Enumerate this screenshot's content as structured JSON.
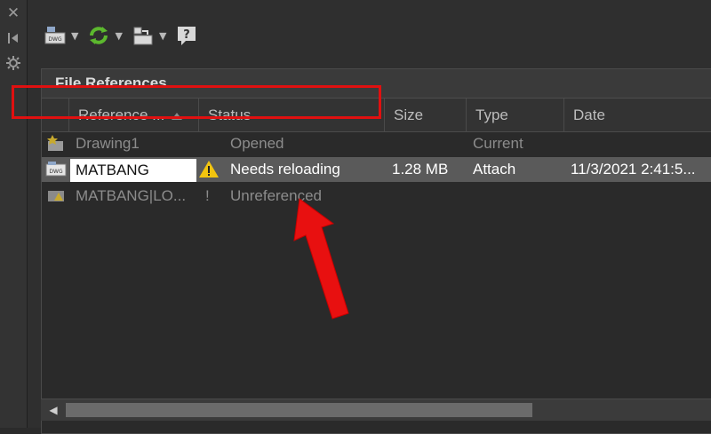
{
  "panel": {
    "title": "File References"
  },
  "toolbar": {
    "buttons": [
      {
        "icon": "attach-dwg-icon",
        "has_dropdown": true
      },
      {
        "icon": "refresh-icon",
        "has_dropdown": true
      },
      {
        "icon": "change-path-icon",
        "has_dropdown": true
      },
      {
        "icon": "help-icon",
        "has_dropdown": false
      }
    ]
  },
  "columns": [
    "Reference ...",
    "Status",
    "Size",
    "Type",
    "Date"
  ],
  "rows": [
    {
      "name": "Drawing1",
      "status": "Opened",
      "size": "",
      "type": "Current",
      "date": "",
      "state": "dim"
    },
    {
      "name": "MATBANG",
      "status": "Needs reloading",
      "size": "1.28 MB",
      "type": "Attach",
      "date": "11/3/2021 2:41:5...",
      "state": "selected"
    },
    {
      "name": "MATBANG|LO...",
      "status": "Unreferenced",
      "size": "",
      "type": "",
      "date": "",
      "state": "dim"
    }
  ],
  "colors": {
    "highlight": "#e01010",
    "warning": "#f2c40f",
    "refresh": "#5cb82e"
  }
}
